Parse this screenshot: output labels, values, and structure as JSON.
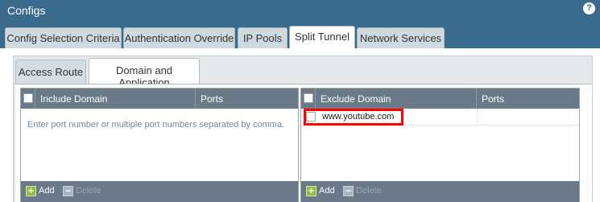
{
  "window": {
    "title": "Configs",
    "help_icon": "?"
  },
  "tabs": [
    {
      "label": "Config Selection Criteria",
      "active": false
    },
    {
      "label": "Authentication Override",
      "active": false
    },
    {
      "label": "IP Pools",
      "active": false
    },
    {
      "label": "Split Tunnel",
      "active": true
    },
    {
      "label": "Network Services",
      "active": false
    }
  ],
  "subtabs": [
    {
      "label": "Access Route",
      "active": false
    },
    {
      "label": "Domain and Application",
      "active": true
    }
  ],
  "include_grid": {
    "col_domain": "Include Domain",
    "col_ports": "Ports",
    "placeholder": "Enter port number or multiple port numbers separated by comma.",
    "add_label": "Add",
    "delete_label": "Delete"
  },
  "exclude_grid": {
    "col_domain": "Exclude Domain",
    "col_ports": "Ports",
    "rows": [
      {
        "domain": "www.youtube.com",
        "ports": ""
      }
    ],
    "add_label": "Add",
    "delete_label": "Delete"
  },
  "colors": {
    "header_blue": "#3b6b8c",
    "grid_header": "#6a7a88",
    "highlight": "#ff0000",
    "add_green": "#8fc043"
  },
  "icons": {
    "help": "help-icon",
    "add": "add-icon",
    "delete": "delete-icon",
    "checkbox": "checkbox-icon"
  }
}
